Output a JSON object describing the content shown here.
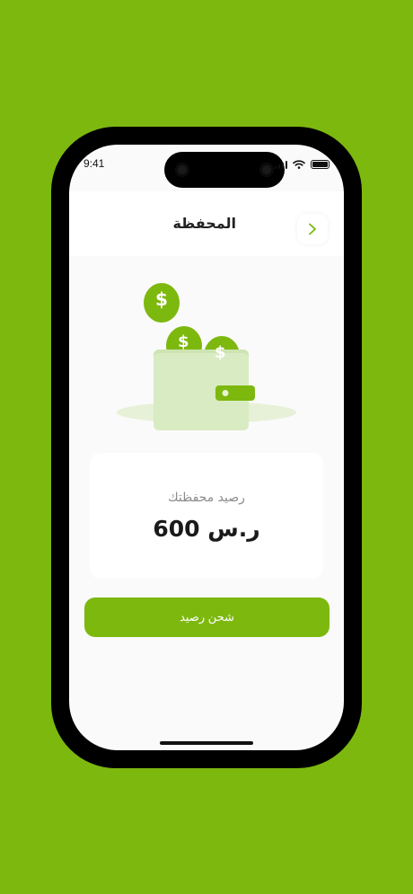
{
  "status_bar": {
    "time": "9:41"
  },
  "header": {
    "title": "المحفظة",
    "back_icon": "chevron-right-icon"
  },
  "illustration": {
    "icon": "wallet-with-coins-icon",
    "coin_symbol": "$"
  },
  "wallet": {
    "balance_label": "رصيد محفظتك",
    "balance_value": "600 ر.س"
  },
  "actions": {
    "top_up_label": "شحن رصيد"
  },
  "colors": {
    "accent": "#7db80f",
    "wallet_body": "#d8ebc2",
    "background": "#fafafa"
  }
}
